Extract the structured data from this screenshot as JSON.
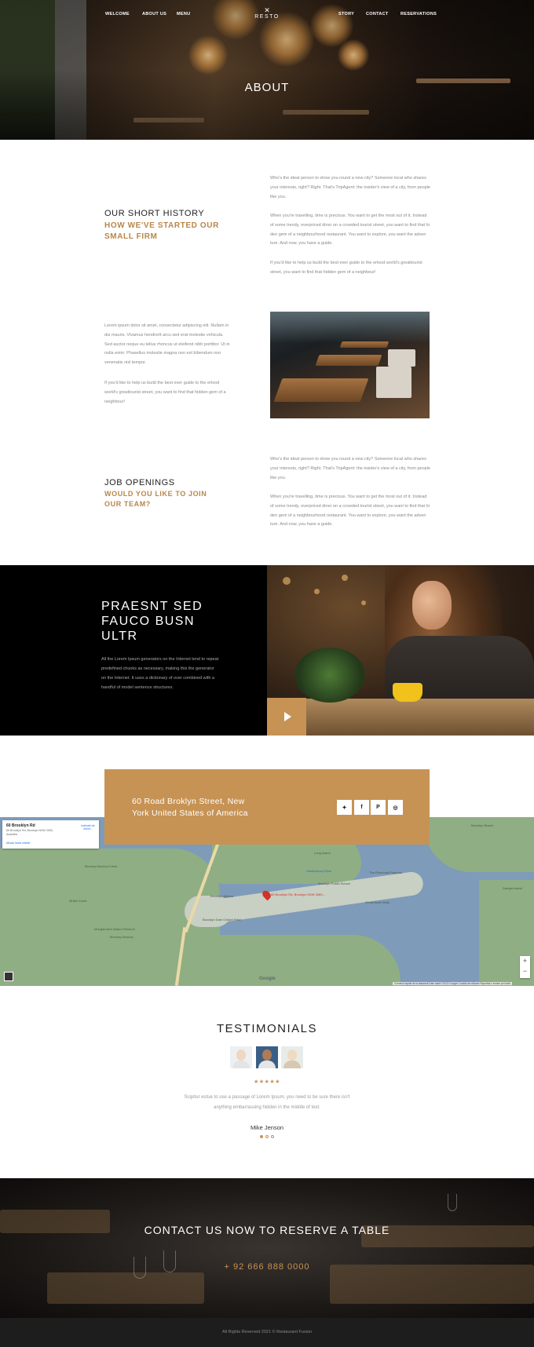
{
  "nav": {
    "left": [
      "WELCOME",
      "ABOUT US",
      "MENU"
    ],
    "right": [
      "STORY",
      "CONTACT",
      "RESERVATIONS"
    ],
    "logo_mark": "✕",
    "logo_text": "RESTO"
  },
  "hero": {
    "title": "ABOUT"
  },
  "history": {
    "title": "OUR SHORT HISTORY",
    "subtitle": "HOW WE'VE STARTED OUR SMALL FIRM",
    "p1": "Who's the ideal person to show you round a new city? Someone local who shares your interests, right? Right. That's TripAgent: the insider's view of a city, from people like you.",
    "p2": "When you're travelling, time is precious. You want to get the most out of it. Instead of some trendy, overpriced diner on a crowded tourist street, you want to find that hi den gem of a neighbourhood restaurant. You want to explore, you want the adven ture. And now, you have a guide.",
    "p3": "If you'd like to help us build the best ever guide to the ertvod world's greattourist street, you want to find that hidden gem of a neighbour!"
  },
  "story": {
    "p1": "Lorem ipsum dolor sit amet, consectetur adipiscing elit. Nullam in dui mauris. Vivamus hendrerit arcu sed erat molestie vehicula. Sed auctor neque eu tellus rhoncus ut eleifend nibh porttitor. Ut in nulla enim. Phasellus molestie magna non est bibendum non venenatis nisl tempor.",
    "p2": "If you'd like to help us build the best ever guide to the ertvod world's greattourist street, you want to find that hidden gem of a neighbour!"
  },
  "jobs": {
    "title": "JOB OPENINGS",
    "subtitle": "WOULD YOU LIKE TO JOIN OUR TEAM?",
    "p1": "Who's the ideal person to show you round a new city? Someone local who shares your interests, right? Right. That's TripAgent: the insider's view of a city, from people like you.",
    "p2": "When you're travelling, time is precious. You want to get the most out of it. Instead of some trendy, overpriced diner on a crowded tourist street, you want to find that hi den gem of a neighbourhood restaurant. You want to explore, you want the adven ture. And now, you have a guide."
  },
  "promo": {
    "title": "PRAESNT SED FAUCO BUSN ULTR",
    "text": "All the Lorem Ipsum generators on the Internet tend to repeat predefined chunks as necessary, making this the generator on the Internet. It uses a dictionary of over combined with a handful of model sentence structures."
  },
  "address": {
    "text": "60 Road Broklyn Street, New York United States of America",
    "social": [
      {
        "icon": "twitter-icon",
        "glyph": "✦"
      },
      {
        "icon": "facebook-icon",
        "glyph": "f"
      },
      {
        "icon": "pinterest-icon",
        "glyph": "P"
      },
      {
        "icon": "instagram-icon",
        "glyph": "◎"
      }
    ]
  },
  "map": {
    "card_title": "60 Brooklyn Rd",
    "card_address": "60 Brooklyn Rd, Brooklyn NSW 2083, Australia",
    "card_link": "Afișați harta mărită",
    "card_directions": "Indicații de orient...",
    "pin_label": "60 Brooklyn Rd, Brooklyn NSW 2083...",
    "labels": [
      "Long Island",
      "Brooklyn Marina",
      "Brooklyn Public School",
      "Great North Walk",
      "Brooklyn Dam Cricket Field",
      "Mooney Mooney Creek",
      "Hawkesbury River",
      "Mullet Creek",
      "Brooklyn Beach",
      "The Riverboat Postman",
      "Mooney Mooney",
      "Muogamarra Nature Reserve",
      "Dangar Island"
    ],
    "google": "Google",
    "footer": "Comenzi rapide de la tastatură   Date hartă ©2022 Google   Condiții de utilizare   Raportați o eroare pe hartă"
  },
  "testimonials": {
    "title": "TESTIMONIALS",
    "stars": "★★★★★",
    "quote": "Scipitur estue to use a passage of Lorem Ipsum, you need to be sure there isn't anything embarrassing hidden in the middle of text.",
    "author": "Mike Jenson"
  },
  "contact": {
    "title": "CONTACT US NOW TO RESERVE A TABLE",
    "phone": "+ 92 666 888 0000"
  },
  "footer": {
    "copyright": "All Rights Reserved 2021 © Restaurant Fusion"
  },
  "colors": {
    "accent": "#c69355",
    "dark": "#000000",
    "footer": "#1d1d1d"
  }
}
